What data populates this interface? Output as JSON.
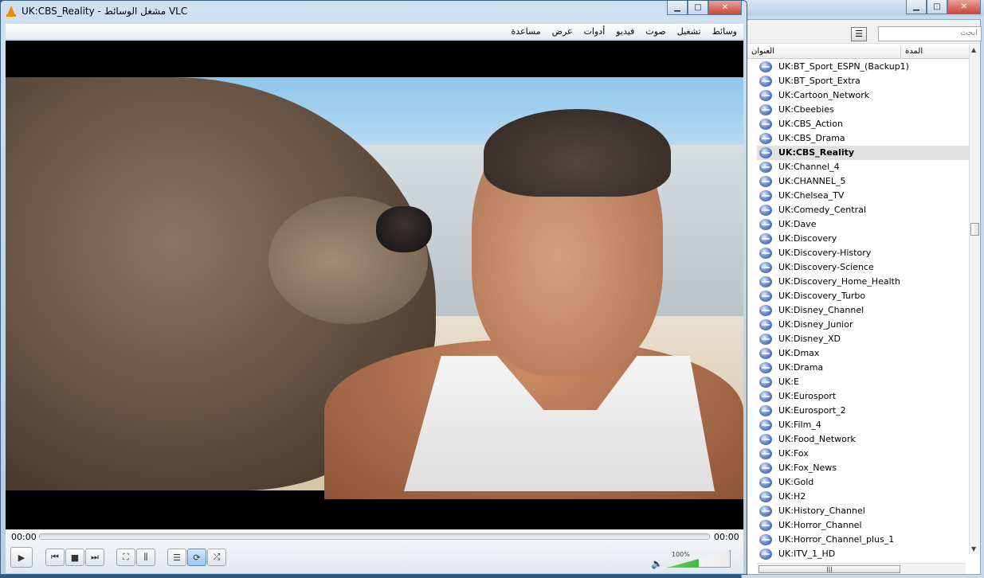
{
  "window": {
    "title": "UK:CBS_Reality - مشغل الوسائط VLC",
    "minimize": "▁",
    "maximize": "□",
    "close": "✕"
  },
  "menu": [
    "وسائط",
    "تشغيل",
    "صوت",
    "فيديو",
    "أدوات",
    "عرض",
    "مساعدة"
  ],
  "player": {
    "elapsed": "00:00",
    "total": "00:00",
    "seek_position": 0,
    "volume_label": "100%",
    "volume_level": 1.0,
    "controls": {
      "play": "▶",
      "prev": "⏮",
      "stop": "■",
      "next": "⏭",
      "fullscreen": "⛶",
      "ext_settings": "⫼",
      "playlist": "☰",
      "loop": "⟳",
      "shuffle": "⤮"
    }
  },
  "playlist": {
    "search_placeholder": "ابحث",
    "view_icon": "☰",
    "col_title": "العنوان",
    "col_duration": "المدة",
    "selected": "UK:CBS_Reality",
    "items": [
      "UK:BT_Sport_ESPN_(Backup1)",
      "UK:BT_Sport_Extra",
      "UK:Cartoon_Network",
      "UK:Cbeebies",
      "UK:CBS_Action",
      "UK:CBS_Drama",
      "UK:CBS_Reality",
      "UK:Channel_4",
      "UK:CHANNEL_5",
      "UK:Chelsea_TV",
      "UK:Comedy_Central",
      "UK:Dave",
      "UK:Discovery",
      "UK:Discovery-History",
      "UK:Discovery-Science",
      "UK:Discovery_Home_Health",
      "UK:Discovery_Turbo",
      "UK:Disney_Channel",
      "UK:Disney_Junior",
      "UK:Disney_XD",
      "UK:Dmax",
      "UK:Drama",
      "UK:E",
      "UK:Eurosport",
      "UK:Eurosport_2",
      "UK:Film_4",
      "UK:Food_Network",
      "UK:Fox",
      "UK:Fox_News",
      "UK:Gold",
      "UK:H2",
      "UK:History_Channel",
      "UK:Horror_Channel",
      "UK:Horror_Channel_plus_1",
      "UK:ITV_1_HD"
    ]
  }
}
